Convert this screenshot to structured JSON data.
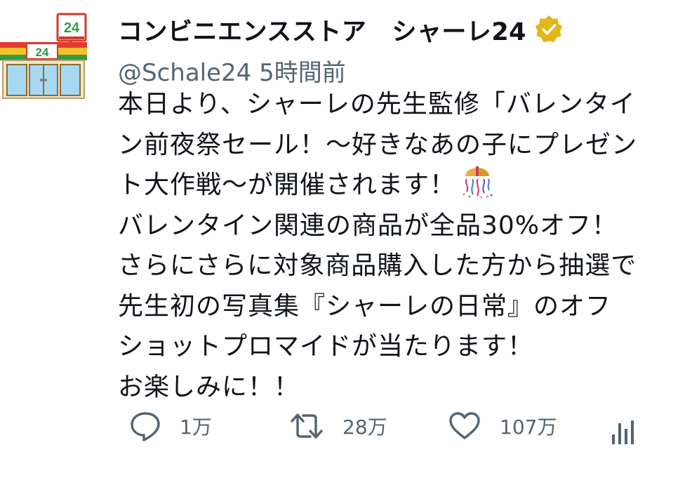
{
  "tweet": {
    "author": {
      "display_name_part1": "コンビニエンスストア",
      "display_name_part2": "シャーレ24",
      "handle": "@Schale24",
      "time_ago": "5時間前",
      "verified": true,
      "avatar_sign_text": "24",
      "avatar_store_text": "24"
    },
    "body_lines": [
      "本日より、シャーレの先生監修「バレンタイ",
      "ン前夜祭セール！～好きなあの子にプレゼン",
      "ト大作戦～が開催されます！",
      "バレンタイン関連の商品が全品30%オフ！",
      "さらにさらに対象商品購入した方から抽選で",
      "先生初の写真集『シャーレの日常』のオフ",
      "ショットプロマイドが当たります！",
      "お楽しみに！！"
    ],
    "metrics": {
      "replies": "1万",
      "retweets": "28万",
      "likes": "107万"
    }
  },
  "icons": {
    "avatar": "convenience-store-icon",
    "badge": "verified-badge-icon",
    "emoji": "party-popper-confetti-icon",
    "reply": "reply-bubble-icon",
    "retweet": "retweet-icon",
    "like": "heart-icon",
    "views": "analytics-bars-icon"
  },
  "colors": {
    "text_primary": "#0f1419",
    "text_secondary": "#536471",
    "badge_gold": "#e2b719",
    "store_red": "#e23b2e",
    "store_green": "#2f9e44",
    "store_yellow": "#f6c12b",
    "store_glass": "#a8d8f0"
  }
}
